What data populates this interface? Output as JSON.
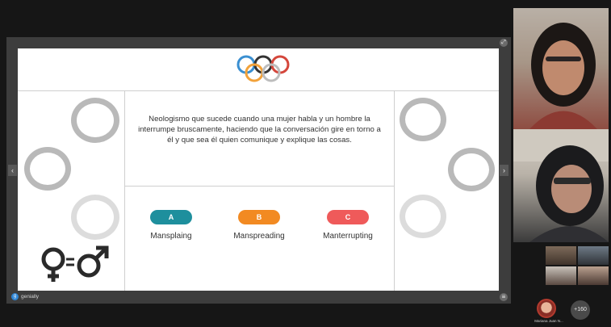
{
  "slide": {
    "question": "Neologismo que sucede cuando una mujer habla y un hombre la interrumpe bruscamente, haciendo que la conversación gire en torno a él y que sea él quien comunique y explique las cosas.",
    "options": [
      {
        "letter": "A",
        "label": "Mansplaing",
        "color": "#1e8f9d"
      },
      {
        "letter": "B",
        "label": "Manspreading",
        "color": "#f28a22"
      },
      {
        "letter": "C",
        "label": "Manterrupting",
        "color": "#ef5a5a"
      }
    ],
    "ring_colors": [
      "#3a8fd1",
      "#f2a23a",
      "#333333",
      "#5fb360",
      "#d4463b"
    ]
  },
  "player": {
    "brand": "genially",
    "prev_icon": "‹",
    "next_icon": "›",
    "menu_icon": "≡",
    "fullscreen_icon": "⤢"
  },
  "participants": {
    "name": "Mariana Juan N...",
    "more_count": "+160"
  }
}
